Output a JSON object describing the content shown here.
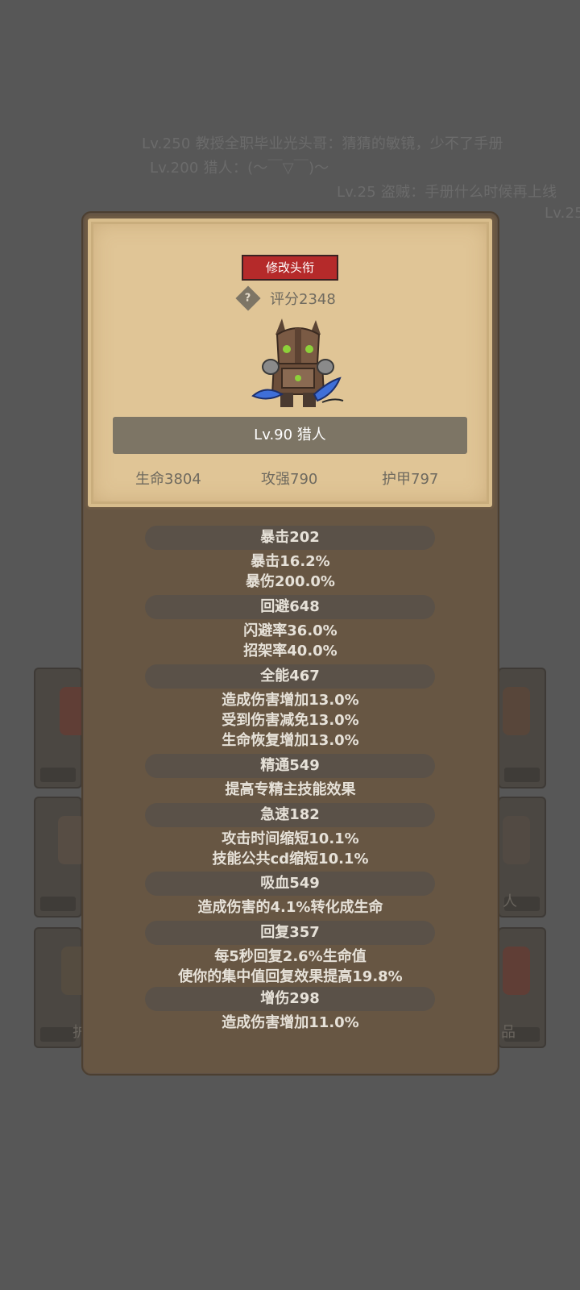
{
  "chat": [
    "Lv.250 教授全职毕业光头哥：猜猜的敏镜，少不了手册",
    "Lv.200 猎人：(～￣▽￣)～",
    "Lv.25 盗贼：手册什么时候再上线",
    "Lv.25"
  ],
  "background_slots": {
    "right_label_1": "人",
    "left_label_2": "护",
    "right_label_2": "品"
  },
  "card": {
    "change_title_button": "修改头衔",
    "help_icon": "question-diamond-icon",
    "score": "评分2348",
    "name_bar": "Lv.90 猎人",
    "stats": {
      "hp": "生命3804",
      "attack": "攻强790",
      "armor": "护甲797"
    }
  },
  "attributes": [
    {
      "header": "暴击202",
      "lines": [
        "暴击16.2%",
        "暴伤200.0%"
      ]
    },
    {
      "header": "回避648",
      "lines": [
        "闪避率36.0%",
        "招架率40.0%"
      ]
    },
    {
      "header": "全能467",
      "lines": [
        "造成伤害增加13.0%",
        "受到伤害减免13.0%",
        "生命恢复增加13.0%"
      ]
    },
    {
      "header": "精通549",
      "lines": [
        "提高专精主技能效果"
      ]
    },
    {
      "header": "急速182",
      "lines": [
        "攻击时间缩短10.1%",
        "技能公共cd缩短10.1%"
      ]
    },
    {
      "header": "吸血549",
      "lines": [
        "造成伤害的4.1%转化成生命"
      ]
    },
    {
      "header": "回复357",
      "lines": [
        "每5秒回复2.6%生命值",
        "使你的集中值回复效果提高19.8%"
      ]
    },
    {
      "header": "增伤298",
      "lines": [
        "造成伤害增加11.0%"
      ]
    }
  ],
  "colors": {
    "background": "#575757",
    "panel": "#675643",
    "card": "#e0c596",
    "button_red": "#b52a2a",
    "name_bar": "#7d7565"
  }
}
